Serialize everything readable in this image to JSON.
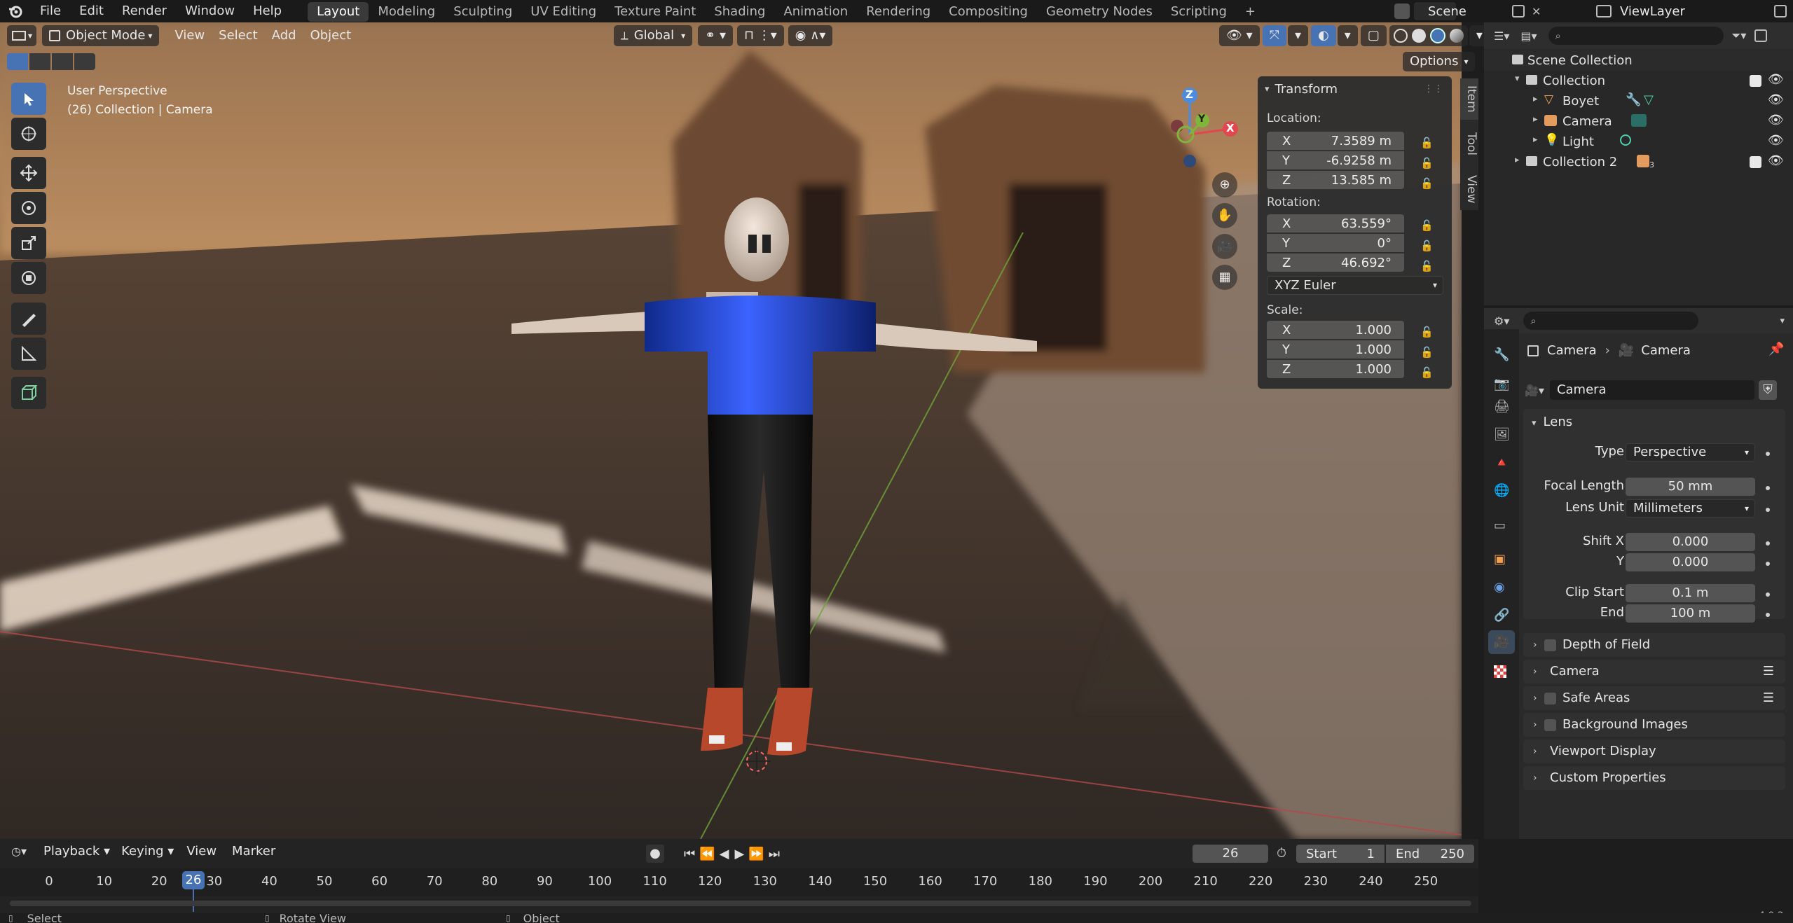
{
  "topbar": {
    "menus": [
      "File",
      "Edit",
      "Render",
      "Window",
      "Help"
    ],
    "workspaces": [
      "Layout",
      "Modeling",
      "Sculpting",
      "UV Editing",
      "Texture Paint",
      "Shading",
      "Animation",
      "Rendering",
      "Compositing",
      "Geometry Nodes",
      "Scripting"
    ],
    "active_workspace": "Layout",
    "scene": "Scene",
    "view_layer": "ViewLayer"
  },
  "viewport": {
    "mode": "Object Mode",
    "menus": [
      "View",
      "Select",
      "Add",
      "Object"
    ],
    "transform_orientation": "Global",
    "options_label": "Options",
    "perspective_label": "User Perspective",
    "context_label": "(26) Collection | Camera",
    "gizmo_axes": {
      "x": "X",
      "y": "Y",
      "z": "Z"
    }
  },
  "transform_panel": {
    "title": "Transform",
    "location_label": "Location:",
    "location": [
      {
        "axis": "X",
        "value": "7.3589 m"
      },
      {
        "axis": "Y",
        "value": "-6.9258 m"
      },
      {
        "axis": "Z",
        "value": "13.585 m"
      }
    ],
    "rotation_label": "Rotation:",
    "rotation": [
      {
        "axis": "X",
        "value": "63.559°"
      },
      {
        "axis": "Y",
        "value": "0°"
      },
      {
        "axis": "Z",
        "value": "46.692°"
      }
    ],
    "rotation_mode": "XYZ Euler",
    "scale_label": "Scale:",
    "scale": [
      {
        "axis": "X",
        "value": "1.000"
      },
      {
        "axis": "Y",
        "value": "1.000"
      },
      {
        "axis": "Z",
        "value": "1.000"
      }
    ]
  },
  "side_tabs": [
    "Item",
    "Tool",
    "View"
  ],
  "outliner": {
    "scene_collection": "Scene Collection",
    "items": [
      {
        "name": "Collection",
        "depth": 1
      },
      {
        "name": "Boyet",
        "depth": 2
      },
      {
        "name": "Camera",
        "depth": 2
      },
      {
        "name": "Light",
        "depth": 2
      },
      {
        "name": "Collection 2",
        "depth": 1
      }
    ],
    "badge_count": "3"
  },
  "properties": {
    "breadcrumb": [
      "Camera",
      "Camera"
    ],
    "datablock_name": "Camera",
    "lens": {
      "title": "Lens",
      "type_label": "Type",
      "type_value": "Perspective",
      "focal_label": "Focal Length",
      "focal_value": "50 mm",
      "unit_label": "Lens Unit",
      "unit_value": "Millimeters",
      "shiftx_label": "Shift X",
      "shiftx_value": "0.000",
      "shifty_label": "Y",
      "shifty_value": "0.000",
      "clipstart_label": "Clip Start",
      "clipstart_value": "0.1 m",
      "clipend_label": "End",
      "clipend_value": "100 m"
    },
    "panels": [
      "Depth of Field",
      "Camera",
      "Safe Areas",
      "Background Images",
      "Viewport Display",
      "Custom Properties"
    ],
    "version": "4.0.2"
  },
  "timeline": {
    "menus": [
      "Playback",
      "Keying",
      "View",
      "Marker"
    ],
    "current_frame": "26",
    "start_label": "Start",
    "start_value": "1",
    "end_label": "End",
    "end_value": "250",
    "ticks": [
      "0",
      "10",
      "20",
      "30",
      "40",
      "50",
      "60",
      "70",
      "80",
      "90",
      "100",
      "110",
      "120",
      "130",
      "140",
      "150",
      "160",
      "170",
      "180",
      "190",
      "200",
      "210",
      "220",
      "230",
      "240",
      "250"
    ],
    "playhead_label": "26"
  },
  "statusbar": {
    "items": [
      "Select",
      "Rotate View",
      "Object"
    ]
  },
  "colors": {
    "accent": "#4772b3",
    "x_axis": "#e2474f",
    "y_axis": "#7fb53b",
    "z_axis": "#4b8be0"
  }
}
